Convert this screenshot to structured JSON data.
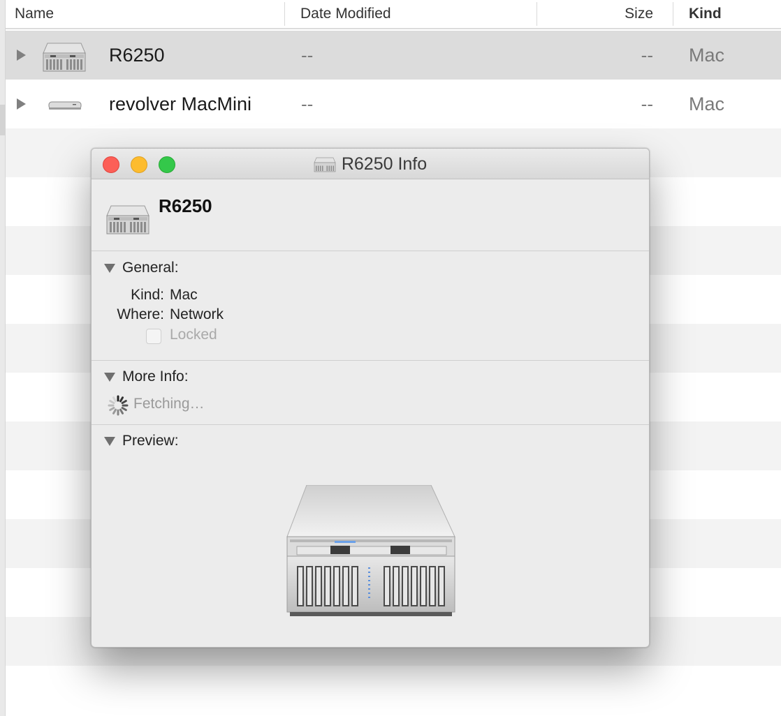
{
  "finder": {
    "columns": {
      "name": "Name",
      "date_modified": "Date Modified",
      "size": "Size",
      "kind": "Kind"
    },
    "rows": [
      {
        "name": "R6250",
        "date": "--",
        "size": "--",
        "kind": "Mac",
        "icon": "xserve-raid-icon",
        "selected": true
      },
      {
        "name": "revolver MacMini",
        "date": "--",
        "size": "--",
        "kind": "Mac",
        "icon": "mac-mini-icon",
        "selected": false
      }
    ]
  },
  "info_window": {
    "title": "R6250 Info",
    "item_name": "R6250",
    "general": {
      "label": "General:",
      "kind_label": "Kind:",
      "kind_value": "Mac",
      "where_label": "Where:",
      "where_value": "Network",
      "locked_label": "Locked",
      "locked": false
    },
    "more_info": {
      "label": "More Info:",
      "status": "Fetching…"
    },
    "preview": {
      "label": "Preview:"
    }
  },
  "colors": {
    "selected_row": "#dcdcdc",
    "close": "#fc5f57",
    "minimize": "#fdbc2e",
    "zoom": "#34c84a"
  }
}
